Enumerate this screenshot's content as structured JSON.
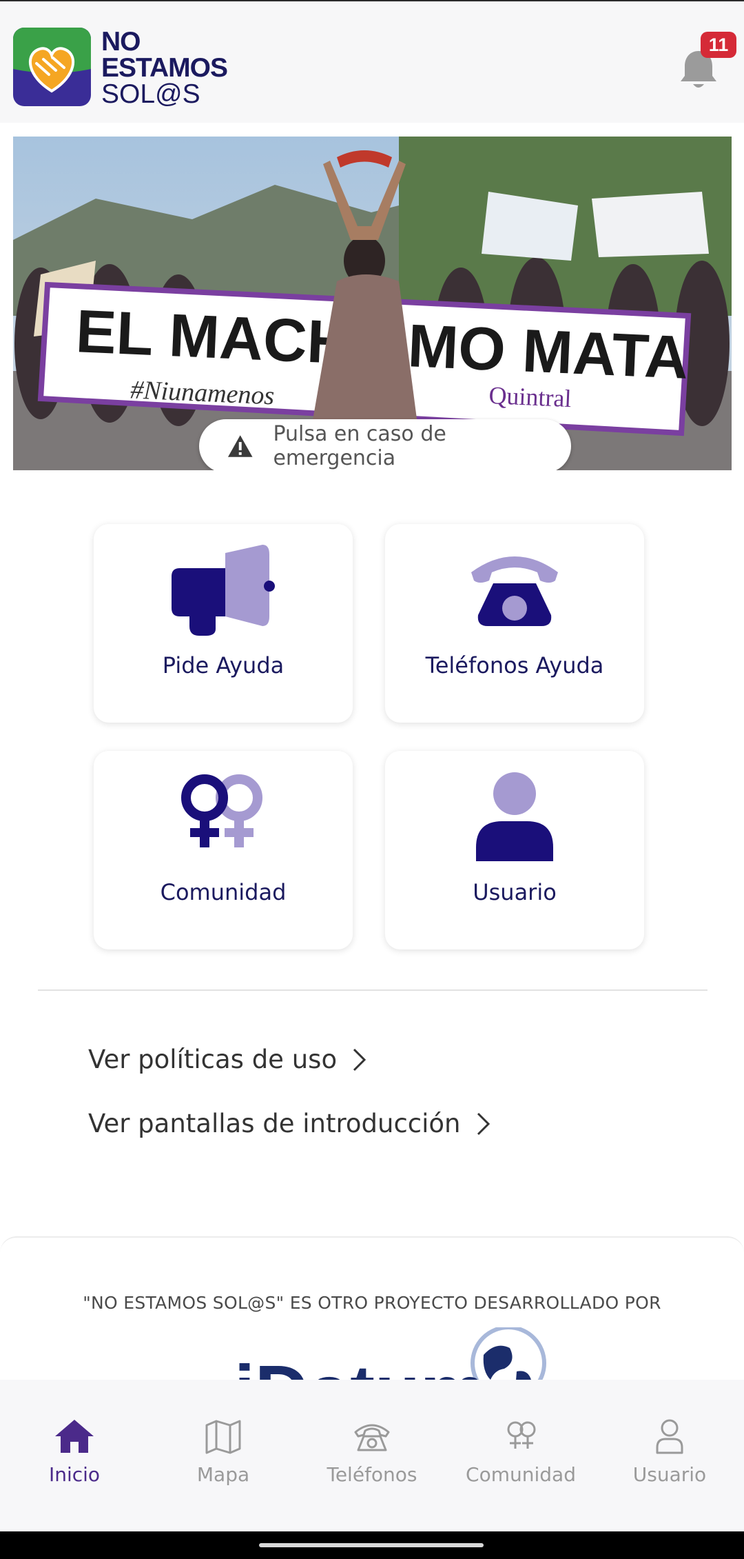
{
  "app": {
    "logo_line1": "NO",
    "logo_line2": "ESTAMOS",
    "logo_line3": "SOL@S",
    "notification_count": "11"
  },
  "banner": {
    "emergency_label": "Pulsa en caso de emergencia",
    "photo_sign_text": "EL MACHISMO MATA",
    "photo_hashtag": "#Niunamenos",
    "photo_org": "Quintral"
  },
  "cards": [
    {
      "label": "Pide Ayuda",
      "icon": "megaphone-icon"
    },
    {
      "label": "Teléfonos Ayuda",
      "icon": "telephone-icon"
    },
    {
      "label": "Comunidad",
      "icon": "female-symbols-icon"
    },
    {
      "label": "Usuario",
      "icon": "user-icon"
    }
  ],
  "links": {
    "policies": "Ver políticas de uso",
    "intro": "Ver pantallas de introducción"
  },
  "footer": {
    "credit": "\"NO ESTAMOS SOL@S\" ES OTRO PROYECTO DESARROLLADO POR",
    "brand_partial": "iDatum"
  },
  "nav": [
    {
      "label": "Inicio",
      "icon": "home-icon",
      "active": true
    },
    {
      "label": "Mapa",
      "icon": "map-icon",
      "active": false
    },
    {
      "label": "Teléfonos",
      "icon": "phone-icon",
      "active": false
    },
    {
      "label": "Comunidad",
      "icon": "community-icon",
      "active": false
    },
    {
      "label": "Usuario",
      "icon": "user-icon",
      "active": false
    }
  ],
  "colors": {
    "brand_navy": "#1b1a5f",
    "brand_purple": "#a59ad1",
    "icon_navy": "#1a0f7a",
    "nav_active": "#4b2a8a",
    "badge_red": "#d52a37",
    "logo_green": "#3aa148",
    "logo_indigo": "#3a2d97",
    "logo_orange": "#f5a623"
  }
}
